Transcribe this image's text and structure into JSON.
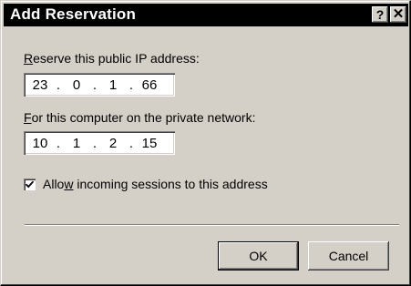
{
  "window": {
    "title": "Add Reservation",
    "help_glyph": "?",
    "close_glyph": "✕"
  },
  "public_ip": {
    "label_mnemonic": "R",
    "label_rest": "eserve this public IP address:",
    "octets": [
      "23",
      "0",
      "1",
      "66"
    ]
  },
  "private_ip": {
    "label_mnemonic": "F",
    "label_rest": "or this computer on the private network:",
    "octets": [
      "10",
      "1",
      "2",
      "15"
    ]
  },
  "allow_incoming": {
    "checked": true,
    "label_pre": "Allo",
    "label_mnemonic": "w",
    "label_post": " incoming sessions to this address"
  },
  "buttons": {
    "ok": "OK",
    "cancel": "Cancel"
  }
}
